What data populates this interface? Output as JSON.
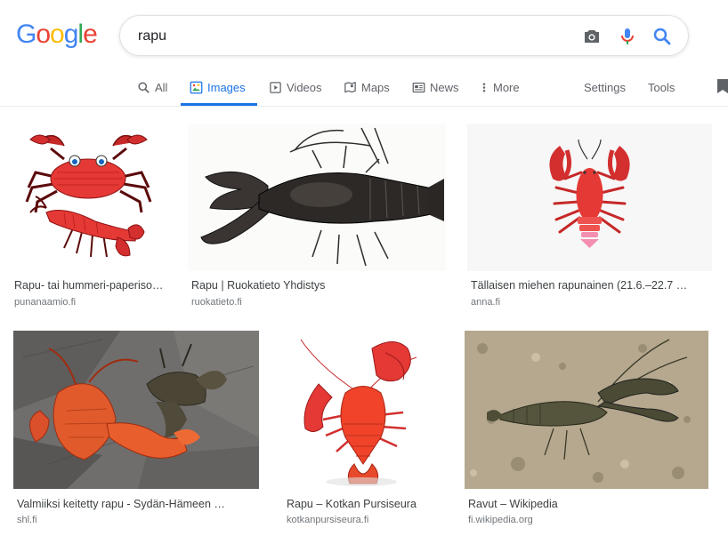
{
  "logo": {
    "letters": [
      "G",
      "o",
      "o",
      "g",
      "l",
      "e"
    ],
    "colors": [
      "#4285f4",
      "#ea4335",
      "#fbbc05",
      "#4285f4",
      "#34a853",
      "#ea4335"
    ]
  },
  "search": {
    "query": "rapu"
  },
  "tabs": {
    "all": "All",
    "images": "Images",
    "videos": "Videos",
    "maps": "Maps",
    "news": "News",
    "more": "More",
    "settings": "Settings",
    "tools": "Tools"
  },
  "accent": "#1a73e8",
  "results": [
    {
      "caption": "Rapu- tai hummeri-paperiso…",
      "source": "punanaamio.fi"
    },
    {
      "caption": "Rapu | Ruokatieto Yhdistys",
      "source": "ruokatieto.fi"
    },
    {
      "caption": "Tällaisen miehen rapunainen (21.6.–22.7 …",
      "source": "anna.fi"
    },
    {
      "caption": "Valmiiksi keitetty rapu - Sydän-Hämeen …",
      "source": "shl.fi"
    },
    {
      "caption": "Rapu – Kotkan Pursiseura",
      "source": "kotkanpursiseura.fi"
    },
    {
      "caption": "Ravut – Wikipedia",
      "source": "fi.wikipedia.org"
    }
  ]
}
